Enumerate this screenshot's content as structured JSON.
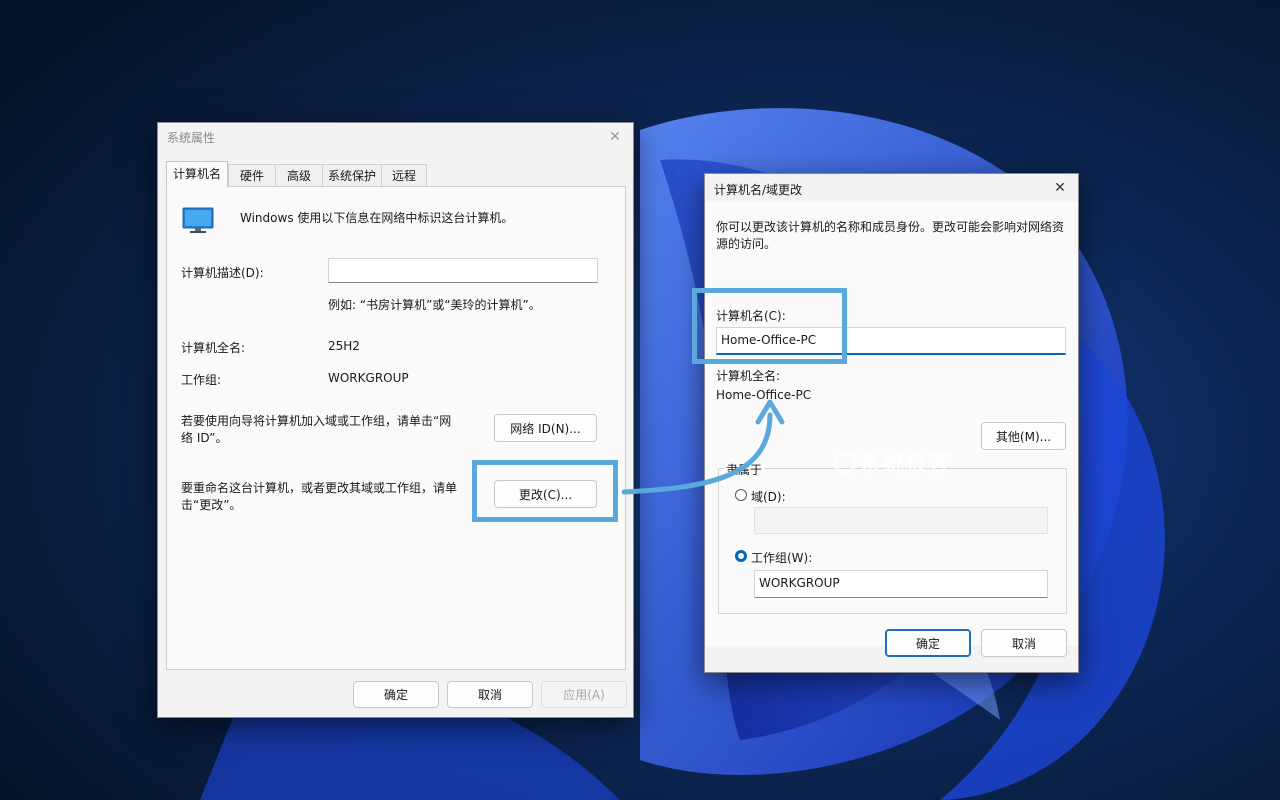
{
  "system_properties": {
    "title": "系统属性",
    "tabs": [
      "计算机名",
      "硬件",
      "高级",
      "系统保护",
      "远程"
    ],
    "active_tab": 0,
    "intro": "Windows 使用以下信息在网络中标识这台计算机。",
    "description_label": "计算机描述(D):",
    "description_value": "",
    "description_example": "例如: “书房计算机”或“美玲的计算机”。",
    "full_name_label": "计算机全名:",
    "full_name_value": "25H2",
    "workgroup_label": "工作组:",
    "workgroup_value": "WORKGROUP",
    "network_id_text": "若要使用向导将计算机加入域或工作组，请单击“网络 ID”。",
    "network_id_button": "网络 ID(N)...",
    "rename_text": "要重命名这台计算机，或者更改其域或工作组，请单击“更改”。",
    "change_button": "更改(C)...",
    "ok_button": "确定",
    "cancel_button": "取消",
    "apply_button": "应用(A)"
  },
  "rename_dialog": {
    "title": "计算机名/域更改",
    "intro": "你可以更改该计算机的名称和成员身份。更改可能会影响对网络资源的访问。",
    "computer_name_label": "计算机名(C):",
    "computer_name_value": "Home-Office-PC",
    "full_name_label": "计算机全名:",
    "full_name_value": "Home-Office-PC",
    "more_button": "其他(M)...",
    "member_of_label": "隶属于",
    "domain_label": "域(D):",
    "domain_value": "",
    "workgroup_label": "工作组(W):",
    "workgroup_value": "WORKGROUP",
    "selected_membership": "workgroup",
    "ok_button": "确定",
    "cancel_button": "取消"
  },
  "watermark": {
    "text": "系统极客"
  },
  "colors": {
    "accent": "#0067c0",
    "highlight": "#5aa8dc",
    "dialog_bg": "#f3f3f3",
    "wallpaper_dark": "#0a1a33",
    "wallpaper_bloom": "#1f4fe0"
  },
  "icons": {
    "computer": "monitor-icon",
    "close": "close-icon"
  }
}
